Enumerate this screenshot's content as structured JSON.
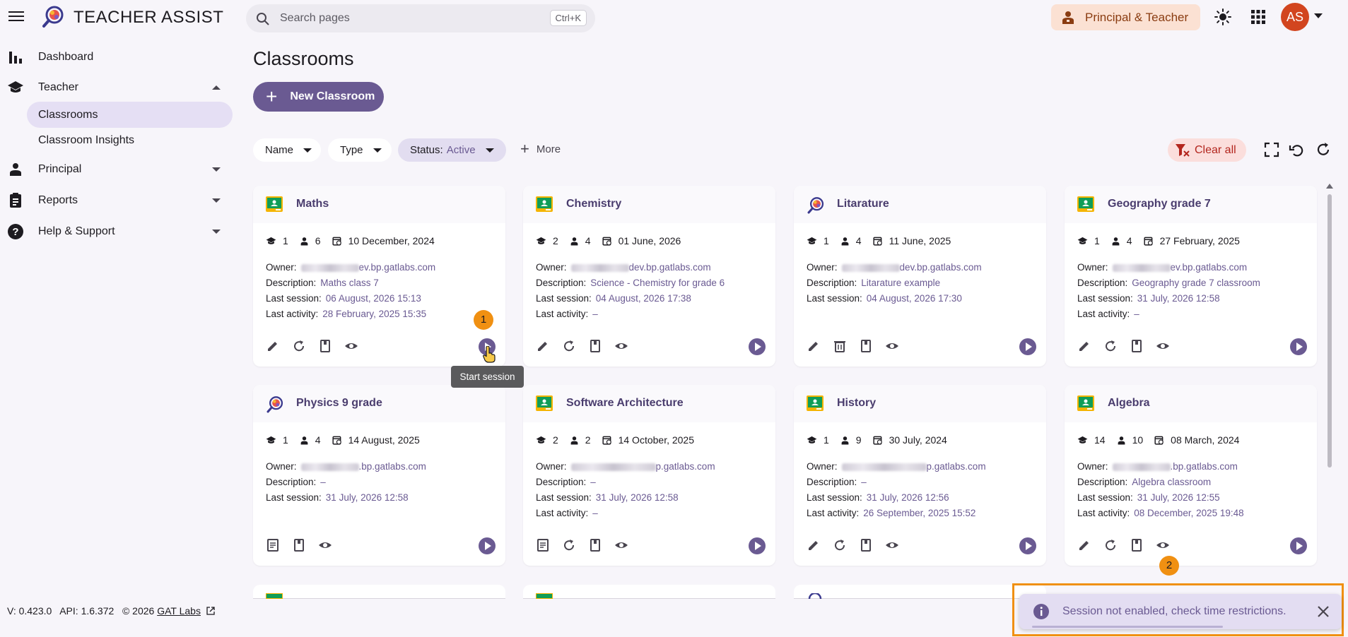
{
  "app": {
    "title": "TEACHER ASSIST"
  },
  "search": {
    "placeholder": "Search pages",
    "shortcut": "Ctrl+K"
  },
  "header": {
    "role_label": "Principal & Teacher",
    "avatar_initials": "AS"
  },
  "sidebar": {
    "items": [
      {
        "label": "Dashboard"
      },
      {
        "label": "Teacher"
      },
      {
        "label": "Principal"
      },
      {
        "label": "Reports"
      },
      {
        "label": "Help & Support"
      }
    ],
    "teacher_sub": [
      {
        "label": "Classrooms"
      },
      {
        "label": "Classroom Insights"
      }
    ]
  },
  "footer": {
    "version": "V: 0.423.0",
    "api": "API: 1.6.372",
    "copyright": "© 2026",
    "link": "GAT Labs"
  },
  "page": {
    "title": "Classrooms",
    "new_button": "New Classroom"
  },
  "filters": {
    "name": "Name",
    "type": "Type",
    "status_label": "Status:",
    "status_value": "Active",
    "more": "More",
    "clear_all": "Clear all"
  },
  "cards": [
    {
      "title": "Maths",
      "classes": "1",
      "students": "6",
      "date": "10 December, 2024",
      "owner_domain": "ev.bp.gatlabs.com",
      "description": "Maths class 7",
      "last_session": "06 August, 2026 15:13",
      "last_activity": "28 February, 2025 15:35"
    },
    {
      "title": "Chemistry",
      "classes": "2",
      "students": "4",
      "date": "01 June, 2026",
      "owner_domain": "dev.bp.gatlabs.com",
      "description": "Science - Chemistry for grade 6",
      "last_session": "04 August, 2026 17:38",
      "last_activity": "–"
    },
    {
      "title": "Litarature",
      "classes": "1",
      "students": "4",
      "date": "11 June, 2025",
      "owner_domain": "dev.bp.gatlabs.com",
      "description": "Litarature example",
      "last_session": "04 August, 2026 17:30"
    },
    {
      "title": "Geography grade 7",
      "classes": "1",
      "students": "4",
      "date": "27 February, 2025",
      "owner_domain": "ev.bp.gatlabs.com",
      "description": "Geography grade 7 classroom",
      "last_session": "31 July, 2026 12:58",
      "last_activity": "–"
    },
    {
      "title": "Physics 9 grade",
      "classes": "1",
      "students": "4",
      "date": "14 August, 2025",
      "owner_domain": ".bp.gatlabs.com",
      "description": "–",
      "last_session": "31 July, 2026 12:58"
    },
    {
      "title": "Software Architecture",
      "classes": "2",
      "students": "2",
      "date": "14 October, 2025",
      "owner_domain": "p.gatlabs.com",
      "description": "–",
      "last_session": "31 July, 2026 12:58",
      "last_activity": "–"
    },
    {
      "title": "History",
      "classes": "1",
      "students": "9",
      "date": "30 July, 2024",
      "owner_domain": "p.gatlabs.com",
      "description": "–",
      "last_session": "31 July, 2026 12:56",
      "last_activity": "26 September, 2025 15:52"
    },
    {
      "title": "Algebra",
      "classes": "14",
      "students": "10",
      "date": "08 March, 2024",
      "owner_domain": ".bp.gatlabs.com",
      "description": "Algebra classroom",
      "last_session": "31 July, 2026 12:55",
      "last_activity": "08 December, 2025 19:48"
    }
  ],
  "labels": {
    "owner": "Owner:",
    "description": "Description:",
    "last_session": "Last session:",
    "last_activity": "Last activity:"
  },
  "annotations": {
    "badge1": "1",
    "badge2": "2",
    "tooltip": "Start session"
  },
  "snackbar": {
    "message": "Session not enabled, check time restrictions."
  },
  "colors": {
    "primary": "#6a5a92",
    "accent_orange": "#f09012",
    "role_bg": "#fbe1d3",
    "avatar": "#d2451f",
    "clear_bg": "#fbdedc"
  }
}
